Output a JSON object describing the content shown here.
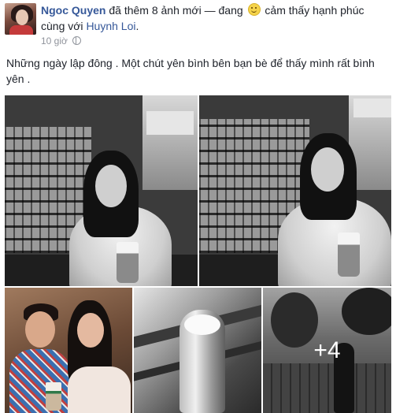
{
  "post": {
    "author": "Ngoc Quyen",
    "action_text": "đã thêm 8 ảnh mới — đang",
    "feeling_text": "cảm thấy hạnh phúc cùng với",
    "tagged_friend": "Huynh Loi",
    "tagged_suffix": ".",
    "timestamp": "10 giờ",
    "privacy_icon": "globe-icon",
    "feeling_icon": "smiley-emoji-icon",
    "message": "Những ngày lập đông . Một chút yên bình bên bạn bè để thấy mình rất bình yên ."
  },
  "photos": {
    "more_count": "+4"
  },
  "colors": {
    "link": "#365899",
    "text": "#1d2129",
    "meta": "#90949c"
  }
}
